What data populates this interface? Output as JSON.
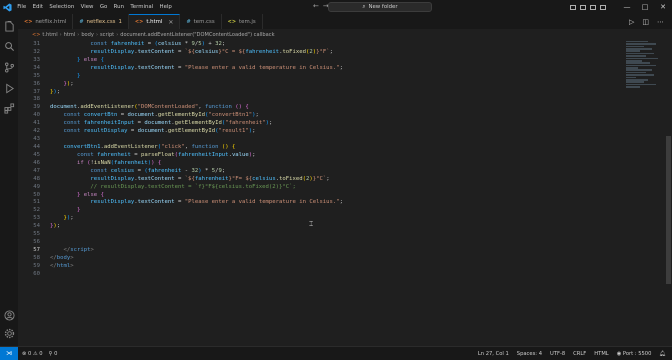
{
  "titlebar": {
    "menu": [
      "File",
      "Edit",
      "Selection",
      "View",
      "Go",
      "Run",
      "Terminal",
      "Help"
    ],
    "search_text": "New folder"
  },
  "tabs": [
    {
      "icon": "<>",
      "label": "netflix.html",
      "modified": "",
      "active": false
    },
    {
      "icon": "#",
      "label": "netflex.css",
      "modified": "1",
      "active": false
    },
    {
      "icon": "<>",
      "label": "t.html",
      "modified": "",
      "active": true
    },
    {
      "icon": "#",
      "label": "tem.css",
      "modified": "",
      "active": false
    },
    {
      "icon": "<>",
      "label": "tem.js",
      "modified": "",
      "active": false
    }
  ],
  "breadcrumb": [
    "t.html",
    "html",
    "body",
    "script",
    "document.addEventListener(\"DOMContentLoaded\") callback"
  ],
  "editor": {
    "line_numbers": [
      "31",
      "32",
      "33",
      "34",
      "35",
      "36",
      "37",
      "38",
      "39",
      "40",
      "41",
      "42",
      "43",
      "44",
      "45",
      "46",
      "47",
      "48",
      "49",
      "50",
      "51",
      "52",
      "53",
      "54",
      "55",
      "56",
      "57",
      "58",
      "59",
      "60"
    ],
    "current_line": "57"
  },
  "statusbar": {
    "errors": "0",
    "warnings": "0",
    "ports": "0",
    "position": "Ln 27, Col 1",
    "spaces": "Spaces: 4",
    "encoding": "UTF-8",
    "eol": "CRLF",
    "language": "HTML",
    "port": "Port : 5500"
  },
  "colors": {
    "accent": "#0078d4",
    "background": "#1f1f1f",
    "chrome": "#181818"
  }
}
